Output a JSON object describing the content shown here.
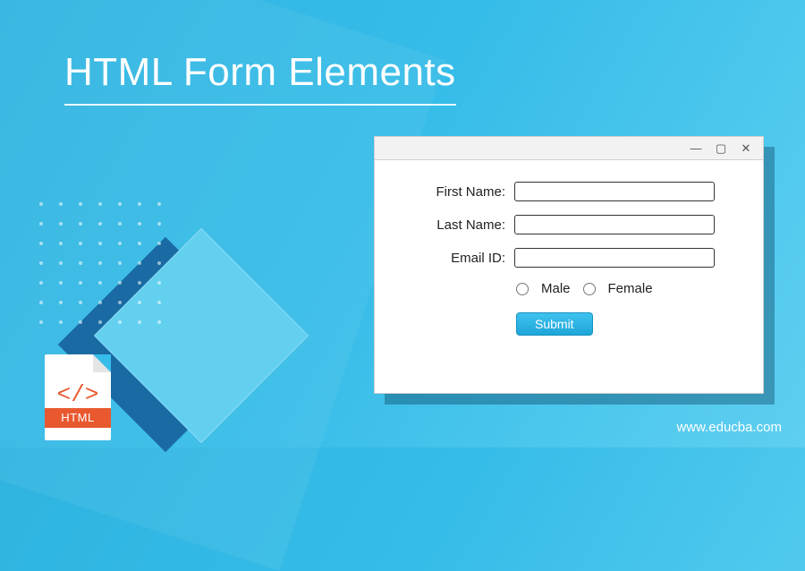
{
  "title": "HTML Form Elements",
  "site_url": "www.educba.com",
  "file_icon": {
    "glyph": "</>",
    "label": "HTML"
  },
  "window": {
    "controls": {
      "minimize": "—",
      "maximize": "▢",
      "close": "✕"
    }
  },
  "form": {
    "first_name": {
      "label": "First Name:",
      "value": ""
    },
    "last_name": {
      "label": "Last Name:",
      "value": ""
    },
    "email": {
      "label": "Email ID:",
      "value": ""
    },
    "gender": {
      "options": [
        {
          "label": "Male"
        },
        {
          "label": "Female"
        }
      ]
    },
    "submit_label": "Submit"
  }
}
